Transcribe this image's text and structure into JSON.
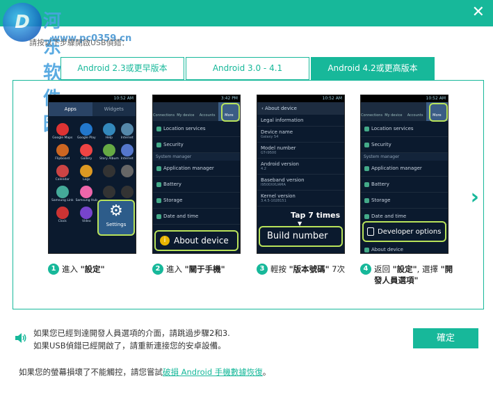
{
  "watermark": {
    "site": "河东软件园",
    "url": "www.pc0359.cn"
  },
  "header": {
    "subtitle": "請按以下步驟開啟USB偵錯："
  },
  "tabs": [
    {
      "label": "Android 2.3或更早版本"
    },
    {
      "label": "Android 3.0 - 4.1"
    },
    {
      "label": "Android 4.2或更高版本"
    }
  ],
  "steps": [
    {
      "number": "1",
      "prefix": "進入 ",
      "bold": "\"設定\"",
      "suffix": "",
      "screen": {
        "tabs": [
          "Apps",
          "Widgets"
        ],
        "highlight": "Settings"
      }
    },
    {
      "number": "2",
      "prefix": "進入 ",
      "bold": "\"關于手機\"",
      "suffix": "",
      "screen": {
        "top": [
          "Connections",
          "My device",
          "Accounts",
          "More"
        ],
        "items": [
          "Location services",
          "Security"
        ],
        "section": "System manager",
        "items2": [
          "Application manager",
          "Battery",
          "Storage",
          "Date and time"
        ],
        "highlight": "About device"
      }
    },
    {
      "number": "3",
      "prefix": "輕按 ",
      "bold": "\"版本號碼\"",
      "suffix": " 7次",
      "screen": {
        "title": "About device",
        "items": [
          {
            "label": "Legal information",
            "sub": ""
          },
          {
            "label": "Device name",
            "sub": "Galaxy S4"
          },
          {
            "label": "Model number",
            "sub": "GT-I9500"
          },
          {
            "label": "Android version",
            "sub": "4.2"
          },
          {
            "label": "Baseband version",
            "sub": "I9500XXUAMA"
          },
          {
            "label": "Kernel version",
            "sub": "3.4.5-1028151"
          }
        ],
        "tap_note": "Tap 7 times",
        "highlight": "Build number"
      }
    },
    {
      "number": "4",
      "prefix": "返回 ",
      "bold": "\"設定\"",
      "suffix": ", 選擇 ",
      "bold2": "\"開發人員選項\"",
      "screen": {
        "top": [
          "Connections",
          "My device",
          "Accounts",
          "More"
        ],
        "items": [
          "Location services",
          "Security"
        ],
        "section": "System manager",
        "items2": [
          "Application manager",
          "Battery",
          "Storage",
          "Date and time"
        ],
        "highlight": "Developer options",
        "after": "About device"
      }
    }
  ],
  "info": {
    "line1": "如果您已經到達開發人員選項的介面，請跳過步驟2和3.",
    "line2": "如果USB偵錯已經開啟了，請重新連接您的安卓設備。"
  },
  "confirm_label": "確定",
  "bottom": {
    "text": "如果您的螢幕損壞了不能觸控，請您嘗試",
    "link": "破損 Android 手機數據恢復",
    "end": "。"
  },
  "colors": {
    "accent": "#17b89a"
  }
}
